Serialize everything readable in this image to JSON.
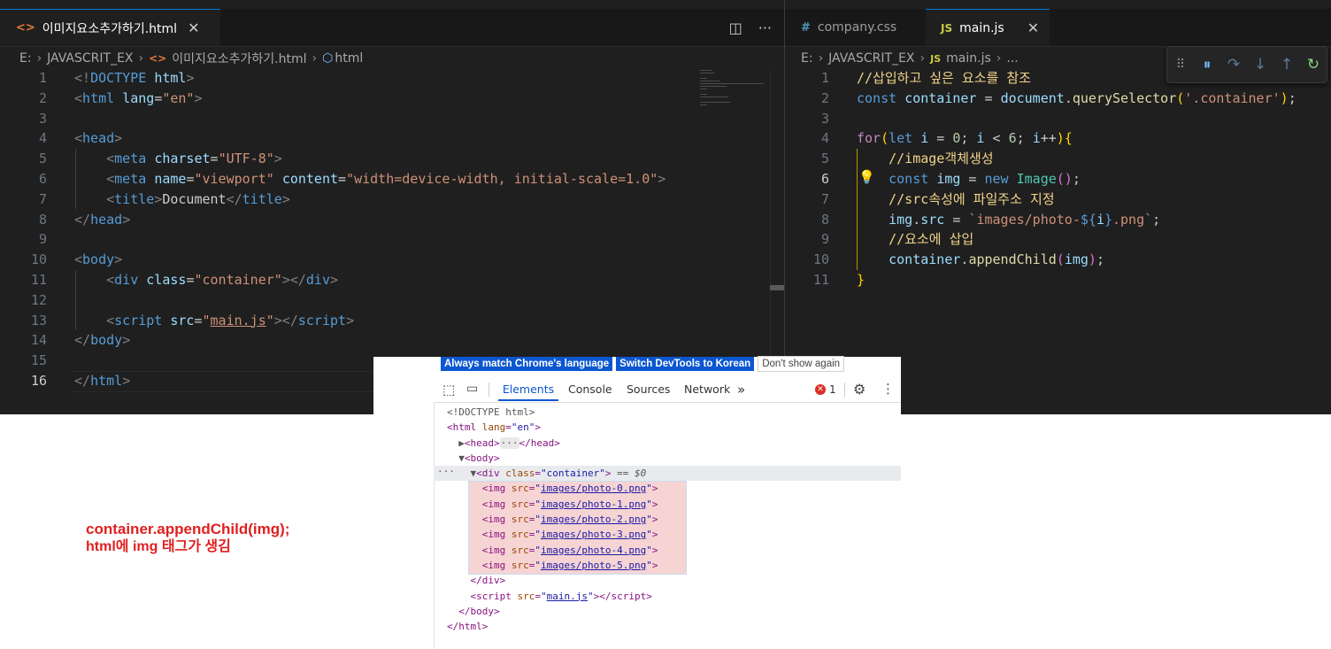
{
  "left_editor": {
    "tab_label": "이미지요소추가하기.html",
    "tab_icon": "<>",
    "tab_close": "✕",
    "split_icon": "◫",
    "more_icon": "···",
    "breadcrumb": [
      "E:",
      "JAVASCRIT_EX",
      "이미지요소추가하기.html",
      "html"
    ],
    "line_numbers": [
      "1",
      "2",
      "3",
      "4",
      "5",
      "6",
      "7",
      "8",
      "9",
      "10",
      "11",
      "12",
      "13",
      "14",
      "15",
      "16"
    ]
  },
  "right_editor": {
    "tabs": [
      {
        "icon": "#",
        "label": "company.css"
      },
      {
        "icon": "JS",
        "label": "main.js",
        "close": "✕"
      }
    ],
    "breadcrumb": [
      "E:",
      "JAVASCRIT_EX",
      "main.js",
      "..."
    ],
    "line_numbers": [
      "1",
      "2",
      "3",
      "4",
      "5",
      "6",
      "7",
      "8",
      "9",
      "10",
      "11"
    ],
    "debug_buttons": [
      "⠿",
      "⏸",
      "↷",
      "↓",
      "↑",
      "↻"
    ]
  },
  "devtools": {
    "lang_buttons": [
      "Always match Chrome's language",
      "Switch DevTools to Korean",
      "Don't show again"
    ],
    "tabs": [
      "Elements",
      "Console",
      "Sources",
      "Network"
    ],
    "more_tabs": "»",
    "error_count": "1",
    "img_srcs": [
      "images/photo-0.png",
      "images/photo-1.png",
      "images/photo-2.png",
      "images/photo-3.png",
      "images/photo-4.png",
      "images/photo-5.png"
    ],
    "script_src": "main.js",
    "selected_marker": "== $0"
  },
  "annotation": {
    "line1": "container.appendChild(img);",
    "line2": "html에 img 태그가 생김"
  },
  "colors": {
    "editor_bg": "#1f1f1f",
    "annotation_red": "#e02020",
    "devtools_blue": "#0b57d0",
    "highlight_pink": "#f6d4d4"
  }
}
